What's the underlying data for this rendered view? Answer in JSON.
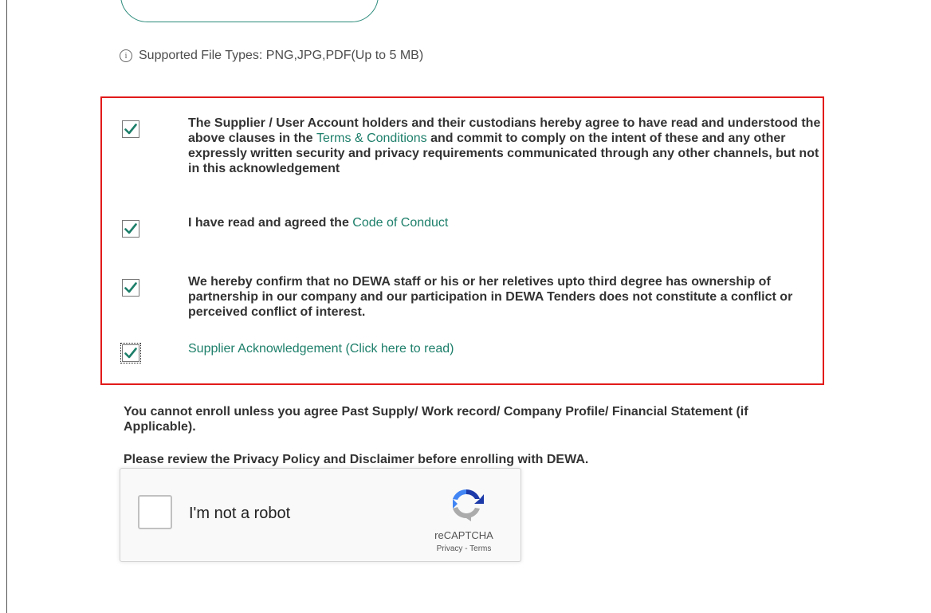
{
  "upload": {
    "file_types_icon": "info-icon",
    "file_types_text": "Supported File Types: PNG,JPG,PDF(Up to 5 MB)"
  },
  "acknowledgements": [
    {
      "checked": true,
      "text_before": "The Supplier / User Account holders and their custodians hereby agree to have read and understood the above clauses in the ",
      "link_text": "Terms & Conditions",
      "text_after": " and commit to comply on the intent of these and any other expressly written security and privacy requirements communicated through any other channels, but not in this acknowledgement"
    },
    {
      "checked": true,
      "text_before": "I have read and agreed the ",
      "link_text": "Code of Conduct",
      "text_after": ""
    },
    {
      "checked": true,
      "text_before": "We hereby confirm that no DEWA staff or his or her reletives upto third degree has ownership of partnership in our company and our participation in DEWA Tenders does not constitute a conflict or perceived conflict of interest.",
      "link_text": "",
      "text_after": ""
    },
    {
      "checked": true,
      "text_before": "",
      "link_text": "Supplier Acknowledgement (Click here to read)",
      "text_after": ""
    }
  ],
  "notices": {
    "enroll_notice": "You cannot enroll unless you agree Past Supply/ Work record/ Company Profile/ Financial Statement (if Applicable).",
    "privacy_notice": "Please review the Privacy Policy and Disclaimer before enrolling with DEWA."
  },
  "captcha": {
    "label": "I'm not a robot",
    "brand": "reCAPTCHA",
    "privacy_link": "Privacy",
    "separator": " - ",
    "terms_link": "Terms"
  },
  "colors": {
    "link": "#1d7f6a",
    "highlight_border": "#e21a1a",
    "checkmark": "#1d7f6a"
  }
}
